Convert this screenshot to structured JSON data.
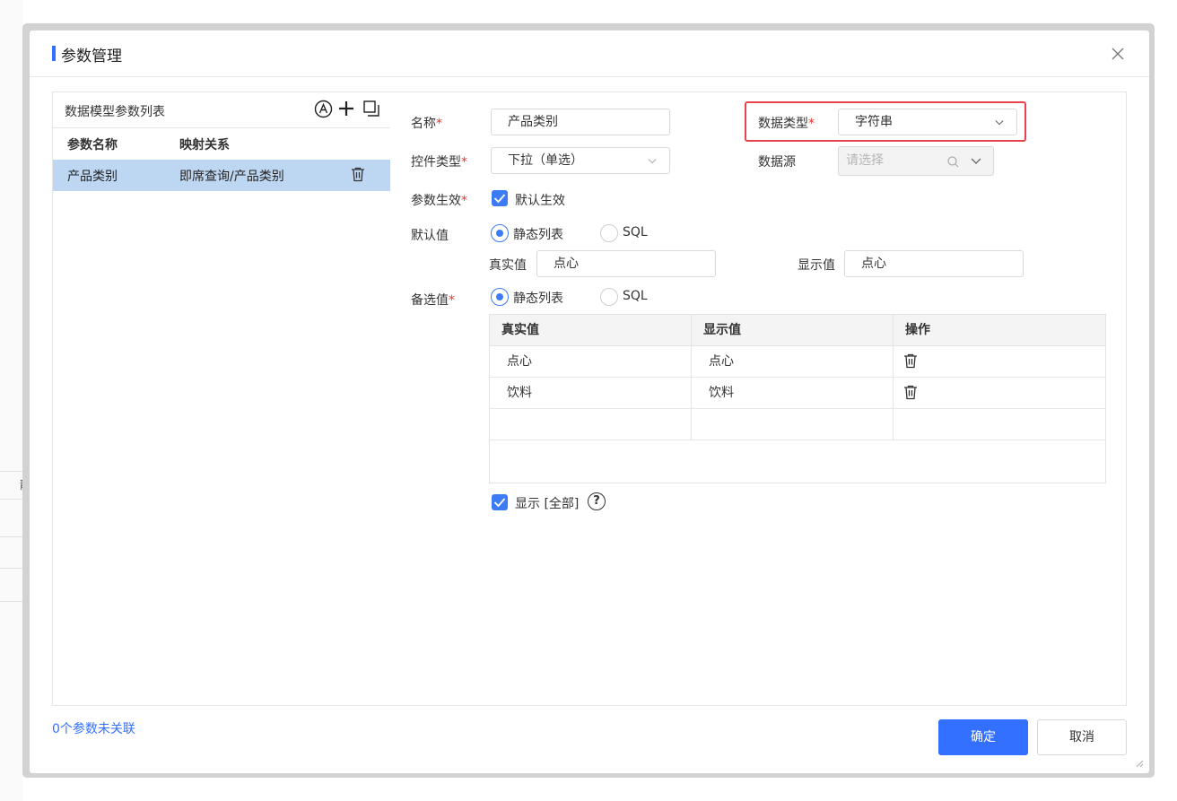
{
  "dialog": {
    "title": "参数管理",
    "close_icon": "close-icon"
  },
  "left_panel": {
    "title": "数据模型参数列表",
    "tools": [
      "auto-icon",
      "plus-icon",
      "copy-icon"
    ],
    "columns": [
      "参数名称",
      "映射关系"
    ],
    "rows": [
      {
        "name": "产品类别",
        "mapping": "即席查询/产品类别"
      }
    ]
  },
  "form": {
    "name_label": "名称",
    "name_value": "产品类别",
    "data_type_label": "数据类型",
    "data_type_value": "字符串",
    "control_type_label": "控件类型",
    "control_type_value": "下拉（单选）",
    "datasource_label": "数据源",
    "datasource_placeholder": "请选择",
    "effect_label": "参数生效",
    "effect_checkbox_label": "默认生效",
    "default_label": "默认值",
    "radio_static": "静态列表",
    "radio_sql": "SQL",
    "real_value_label": "真实值",
    "real_value": "点心",
    "display_value_label": "显示值",
    "display_value": "点心",
    "options_label": "备选值",
    "options_radio_static": "静态列表",
    "options_radio_sql": "SQL",
    "required_mark": "*"
  },
  "options_table": {
    "columns": [
      "真实值",
      "显示值",
      "操作"
    ],
    "rows": [
      {
        "real": "点心",
        "display": "点心"
      },
      {
        "real": "饮料",
        "display": "饮料"
      }
    ]
  },
  "show_all": {
    "label": "显示 [全部]",
    "help": "?"
  },
  "footer": {
    "unlinked_text": "0个参数未关联",
    "confirm": "确定",
    "cancel": "取消"
  },
  "colors": {
    "accent": "#3370ff",
    "selected_row": "#bdd7f3",
    "highlight_border": "#e7434f",
    "required": "#e8352f"
  }
}
